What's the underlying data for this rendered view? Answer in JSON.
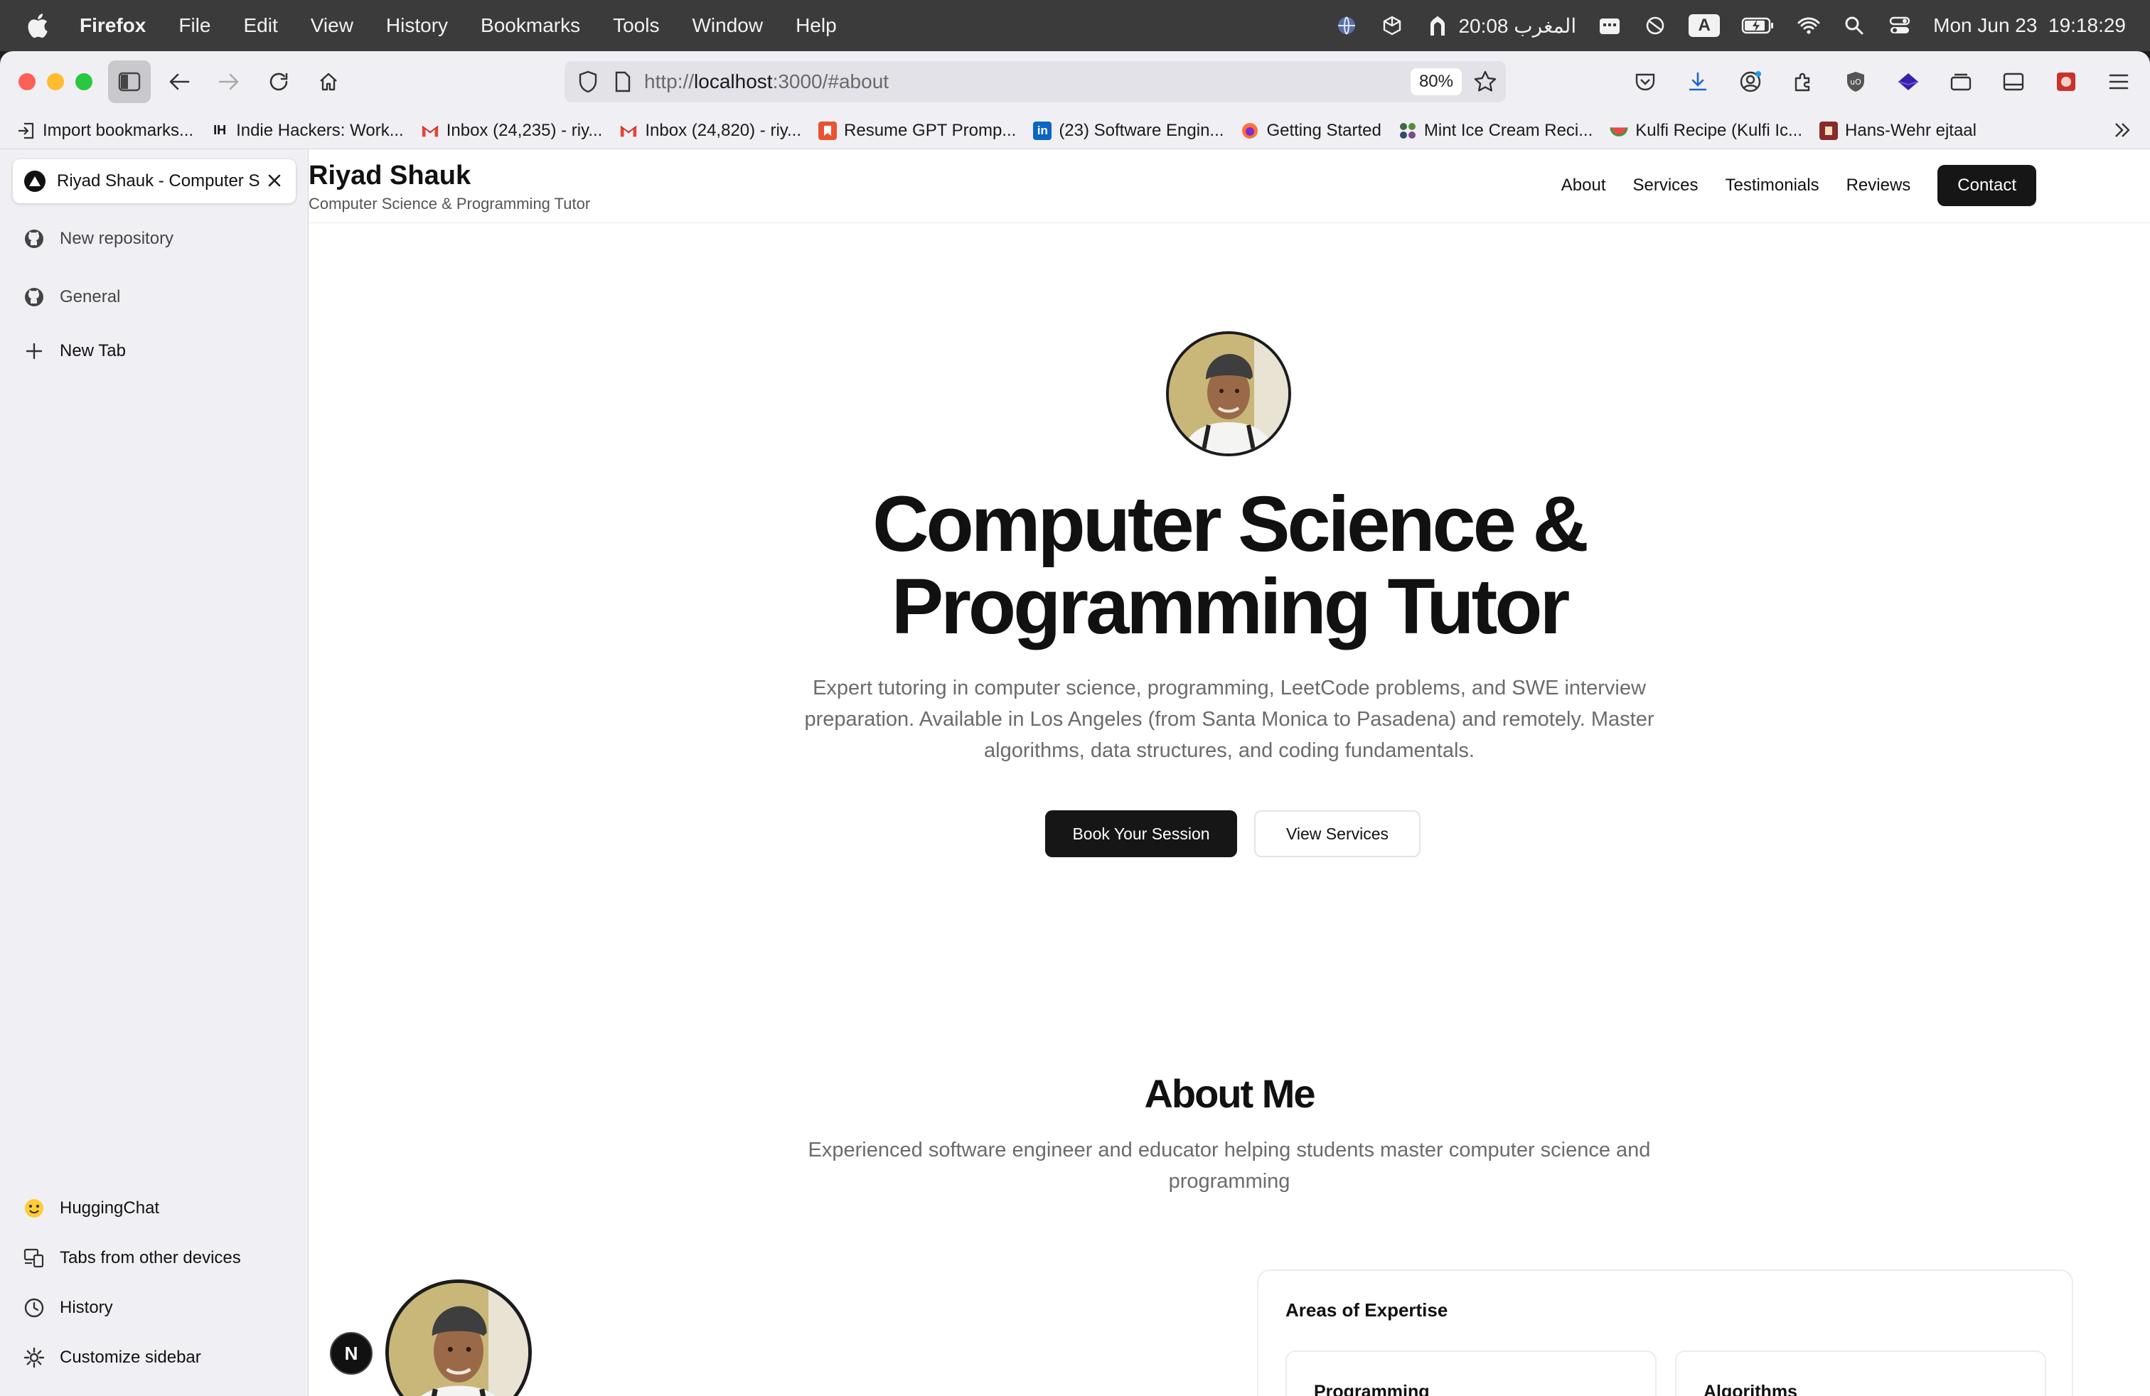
{
  "menubar": {
    "app_name": "Firefox",
    "items": [
      "File",
      "Edit",
      "View",
      "History",
      "Bookmarks",
      "Tools",
      "Window",
      "Help"
    ],
    "prayer_time": "20:08 المغرب",
    "input_source": "A",
    "datetime": "Mon Jun 23  19:18:29"
  },
  "browser": {
    "url_prefix": "http://",
    "url_host": "localhost",
    "url_rest": ":3000/#about",
    "zoom": "80%"
  },
  "bookmarks": [
    {
      "label": "Import bookmarks...",
      "icon": "import-icon"
    },
    {
      "label": "Indie Hackers: Work...",
      "icon": "IH"
    },
    {
      "label": "Inbox (24,235) - riy...",
      "icon": "gmail-icon"
    },
    {
      "label": "Inbox (24,820) - riy...",
      "icon": "gmail-icon"
    },
    {
      "label": "Resume GPT Promp...",
      "icon": "bookmark-icon"
    },
    {
      "label": "(23) Software Engin...",
      "icon": "in"
    },
    {
      "label": "Getting Started",
      "icon": "firefox-icon"
    },
    {
      "label": "Mint Ice Cream Reci...",
      "icon": "dots-icon"
    },
    {
      "label": "Kulfi Recipe (Kulfi Ic...",
      "icon": "melon-icon"
    },
    {
      "label": "Hans-Wehr ejtaal",
      "icon": "book-icon"
    }
  ],
  "sidebar": {
    "active_tab": "Riyad Shauk - Computer Science & Programming Tutor",
    "items": [
      {
        "label": "New repository"
      },
      {
        "label": "General"
      },
      {
        "label": "New Tab"
      }
    ],
    "bottom": [
      {
        "label": "HuggingChat"
      },
      {
        "label": "Tabs from other devices"
      },
      {
        "label": "History"
      },
      {
        "label": "Customize sidebar"
      }
    ]
  },
  "site": {
    "brand": "Riyad Shauk",
    "tagline": "Computer Science & Programming Tutor",
    "nav": [
      "About",
      "Services",
      "Testimonials",
      "Reviews"
    ],
    "contact": "Contact",
    "hero_title_1": "Computer Science &",
    "hero_title_2": "Programming Tutor",
    "hero_desc": "Expert tutoring in computer science, programming, LeetCode problems, and SWE interview preparation. Available in Los Angeles (from Santa Monica to Pasadena) and remotely. Master algorithms, data structures, and coding fundamentals.",
    "btn_book": "Book Your Session",
    "btn_services": "View Services",
    "about_title": "About Me",
    "about_sub": "Experienced software engineer and educator helping students master computer science and programming",
    "expertise_title": "Areas of Expertise",
    "expertise": [
      "Programming",
      "Algorithms"
    ],
    "next_badge": "N"
  }
}
